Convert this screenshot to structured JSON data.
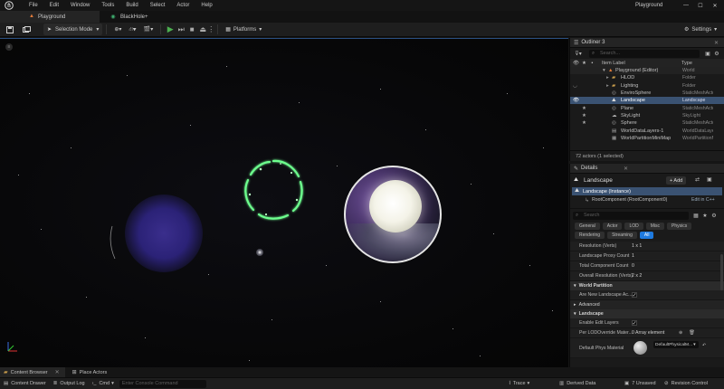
{
  "menu": {
    "items": [
      "File",
      "Edit",
      "Window",
      "Tools",
      "Build",
      "Select",
      "Actor",
      "Help"
    ],
    "project_title": "Playground"
  },
  "doc_tabs": [
    {
      "label": "Playground",
      "active": true
    },
    {
      "label": "BlackHole+",
      "active": false
    }
  ],
  "toolbar": {
    "selection_mode": "Selection Mode",
    "platforms": "Platforms",
    "settings": "Settings"
  },
  "outliner": {
    "tab_title": "Outliner 3",
    "search_placeholder": "Search...",
    "col_label": "Item Label",
    "col_type": "Type",
    "rows": [
      {
        "label": "Playground (Editor)",
        "type": "World"
      },
      {
        "label": "HLOD",
        "type": "Folder"
      },
      {
        "label": "Lighting",
        "type": "Folder"
      },
      {
        "label": "EnviroSphere",
        "type": "StaticMeshActor"
      },
      {
        "label": "Landscape",
        "type": "Landscape"
      },
      {
        "label": "Plane",
        "type": "StaticMeshActor"
      },
      {
        "label": "SkyLight",
        "type": "SkyLight"
      },
      {
        "label": "Sphere",
        "type": "StaticMeshActor"
      },
      {
        "label": "WorldDataLayers-1",
        "type": "WorldDataLayers"
      },
      {
        "label": "WorldPartitionMiniMap",
        "type": "WorldPartitionMiniMap"
      }
    ],
    "footer": "72 actors (1 selected)"
  },
  "details": {
    "tab_title": "Details",
    "actor_name": "Landscape",
    "add_label": "+ Add",
    "instance_label": "Landscape (Instance)",
    "root_component": "RootComponent (RootComponent0)",
    "edit_link": "Edit in C++",
    "search_placeholder": "Search",
    "filter_tabs_row1": [
      "General",
      "Actor",
      "LOD",
      "Misc",
      "Physics"
    ],
    "filter_tabs_row2": [
      "Rendering",
      "Streaming",
      "All"
    ],
    "props_top": [
      {
        "label": "Resolution (Verts)",
        "value": "1 x 1"
      },
      {
        "label": "Landscape Proxy Count",
        "value": "1"
      },
      {
        "label": "Total Component Count",
        "value": "0"
      },
      {
        "label": "Overall Resolution (Verts)",
        "value": "2 x 2"
      }
    ],
    "section_world_partition": "World Partition",
    "prop_are_new": "Are New Landscape Ac...",
    "section_advanced": "Advanced",
    "section_landscape": "Landscape",
    "prop_enable_edit_layers": "Enable Edit Layers",
    "prop_per_lod": "Per LODOverride Mater...",
    "per_lod_value": "0 Array element",
    "prop_phys_material": "Default Phys Material",
    "phys_material_value": "DefaultPhysicalM..."
  },
  "drawer": {
    "content_browser": "Content Browser",
    "place_actors": "Place Actors"
  },
  "status": {
    "content_drawer": "Content Drawer",
    "output_log": "Output Log",
    "cmd": "Cmd",
    "console_placeholder": "Enter Console Command",
    "trace": "Trace",
    "derived_data": "Derived Data",
    "unsaved": "7 Unsaved",
    "revision_control": "Revision Control"
  },
  "colors": {
    "accent": "#1e7ae0",
    "selection": "#3a5272",
    "play_green": "#4caf50",
    "ring_green": "#6dff8e"
  }
}
